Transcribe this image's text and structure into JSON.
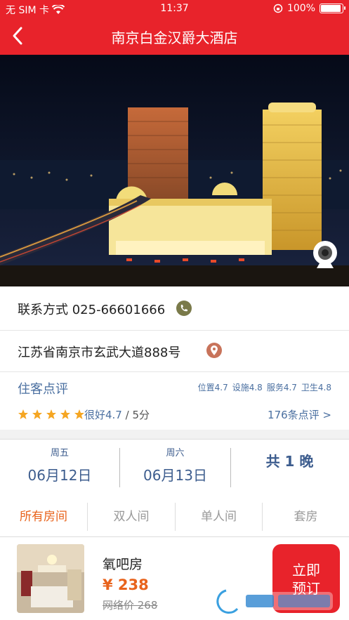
{
  "status": {
    "carrier": "无 SIM 卡",
    "time": "11:37",
    "battery": "100%",
    "battery_level": 1.0
  },
  "nav": {
    "title": "南京白金汉爵大酒店"
  },
  "contact": {
    "label": "联系方式 025-66601666"
  },
  "address": {
    "text": "江苏省南京市玄武大道888号"
  },
  "review": {
    "title": "住客点评",
    "scores": [
      "位置4.7",
      "设施4.8",
      "服务4.7",
      "卫生4.8"
    ],
    "stars": 5,
    "good_label": "很好4.7",
    "scale": " / 5分",
    "count": "176条点评 >"
  },
  "dates": {
    "checkin_weekday": "周五",
    "checkin_date": "06月12日",
    "checkout_weekday": "周六",
    "checkout_date": "06月13日",
    "nights": "共 1 晚"
  },
  "tabs": [
    "所有房间",
    "双人间",
    "单人间",
    "套房"
  ],
  "room": {
    "name": "氧吧房",
    "price": "¥ 238",
    "original": "网络价 268"
  },
  "book_button": "立即预订",
  "colors": {
    "brand_red": "#e8232b",
    "accent_orange": "#e8631c",
    "link_blue": "#4a6fa0",
    "star_gold": "#f5a623"
  }
}
